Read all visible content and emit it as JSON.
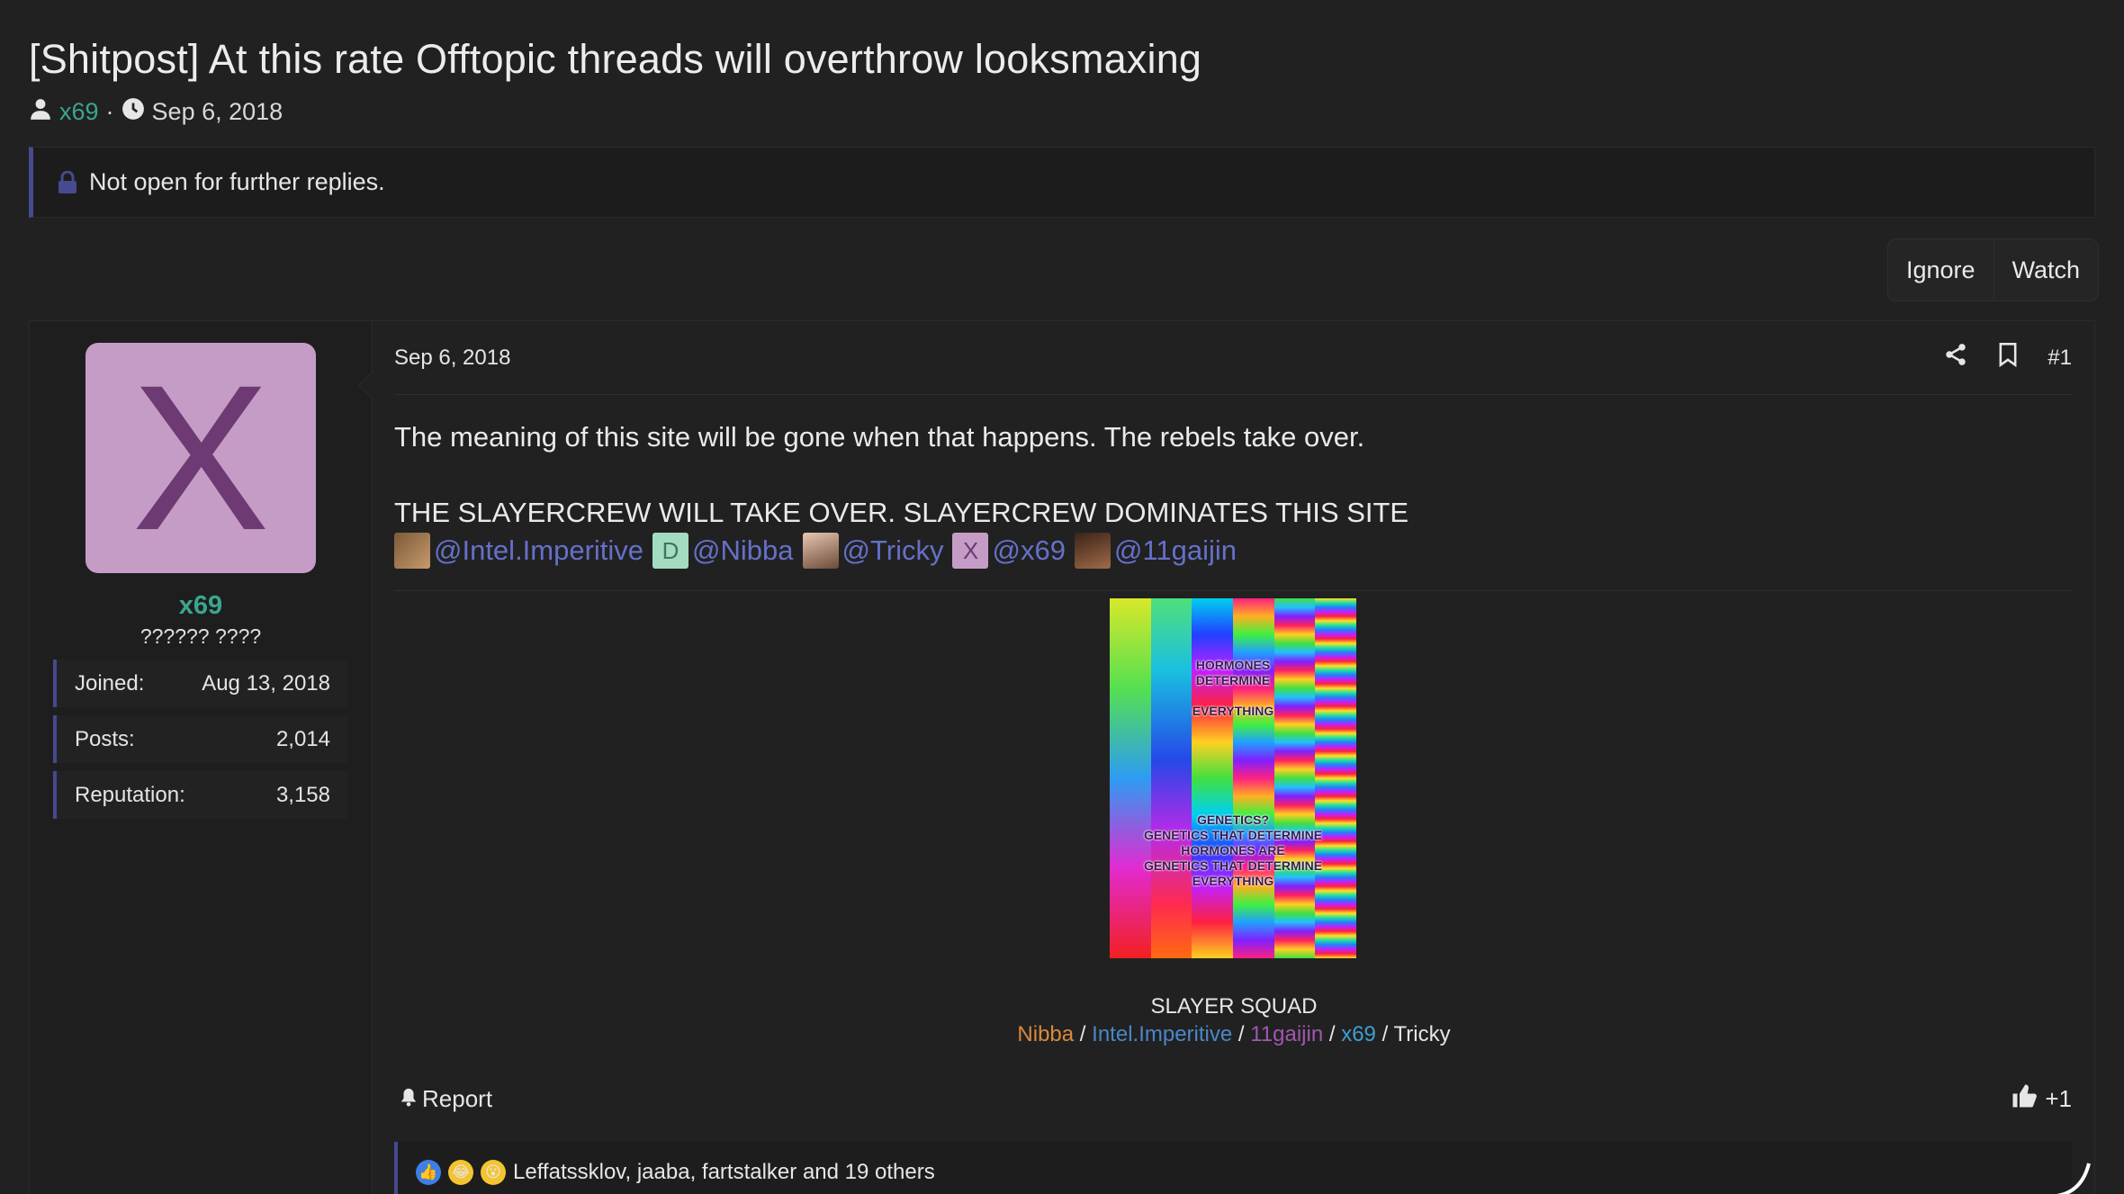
{
  "thread": {
    "title": "[Shitpost] At this rate Offtopic threads will overthrow looksmaxing",
    "author": "x69",
    "separator": "·",
    "date": "Sep 6, 2018",
    "notice": "Not open for further replies."
  },
  "buttons": {
    "ignore": "Ignore",
    "watch": "Watch"
  },
  "user": {
    "avatar_letter": "X",
    "name": "x69",
    "title": "?????? ????",
    "stats": [
      {
        "label": "Joined:",
        "value": "Aug 13, 2018"
      },
      {
        "label": "Posts:",
        "value": "2,014"
      },
      {
        "label": "Reputation:",
        "value": "3,158"
      }
    ]
  },
  "post": {
    "date": "Sep 6, 2018",
    "number": "#1",
    "line1": "The meaning of this site will be gone when that happens. The rebels take over.",
    "line2": "THE SLAYERCREW WILL TAKE OVER. SLAYERCREW DOMINATES THIS SITE",
    "mentions": [
      {
        "name": "@Intel.Imperitive",
        "avatar": ""
      },
      {
        "name": "@Nibba",
        "avatar": "D"
      },
      {
        "name": "@Tricky",
        "avatar": ""
      },
      {
        "name": "@x69",
        "avatar": "X"
      },
      {
        "name": "@11gaijin",
        "avatar": ""
      }
    ],
    "image_text_top": [
      "HORMONES",
      "DETERMINE",
      "",
      "EVERYTHING"
    ],
    "image_text_bottom": [
      "GENETICS?",
      "GENETICS THAT DETERMINE",
      "HORMONES ARE",
      "GENETICS THAT DETERMINE",
      "EVERYTHING"
    ],
    "signature_title": "SLAYER SQUAD",
    "signature_links": [
      "Nibba",
      "Intel.Imperitive",
      "11gaijin",
      "x69",
      "Tricky"
    ],
    "signature_sep": " / ",
    "report": "Report",
    "like_count": "+1",
    "reactions_text": "Leffatssklov, jaaba, fartstalker and 19 others"
  },
  "colors": {
    "background": "#212121",
    "accent": "#464a8e",
    "username": "#3ba58f",
    "mention": "#6570c9"
  }
}
